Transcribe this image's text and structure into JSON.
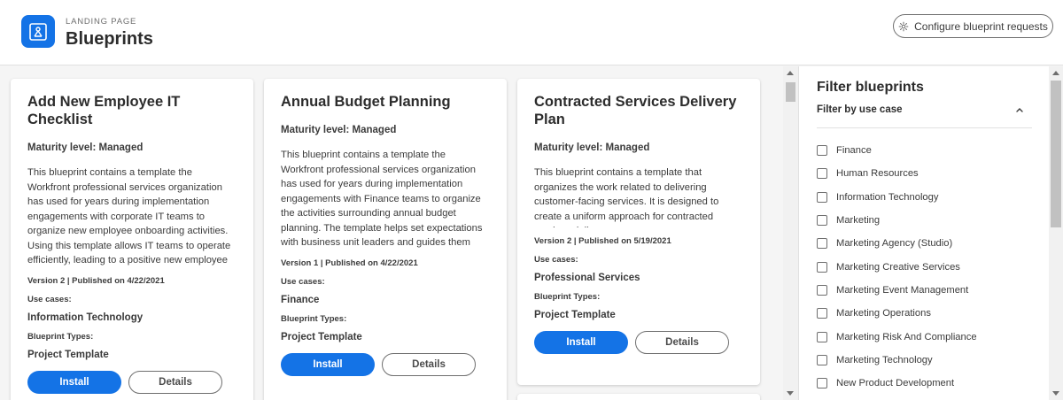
{
  "header": {
    "eyebrow": "LANDING PAGE",
    "title": "Blueprints",
    "config_button": "Configure blueprint requests"
  },
  "labels": {
    "use_cases": "Use cases:",
    "blueprint_types": "Blueprint Types:",
    "install": "Install",
    "details": "Details"
  },
  "cards": [
    {
      "title": "Add New Employee IT Checklist",
      "maturity": "Maturity level: Managed",
      "description": "This blueprint contains a template the Workfront professional services organization has used for years during implementation engagements with corporate IT teams to organize new employee onboarding activities. Using this template allows IT teams to operate efficiently, leading to a positive new employee experience and faster…",
      "version": "Version 2 | Published on 4/22/2021",
      "use_case": "Information Technology",
      "blueprint_type": "Project Template"
    },
    {
      "title": "Annual Budget Planning",
      "maturity": "Maturity level: Managed",
      "description": "This blueprint contains a template the Workfront professional services organization has used for years during implementation engagements with Finance teams to organize the activities surrounding annual budget planning. The template helps set expectations with business unit leaders and guides them through the proce…",
      "version": "Version 1 | Published on 4/22/2021",
      "use_case": "Finance",
      "blueprint_type": "Project Template"
    },
    {
      "title": "Contracted Services Delivery Plan",
      "maturity": "Maturity level: Managed",
      "description": "This blueprint contains a template that organizes the work related to delivering customer-facing services. It is designed to create a uniform approach for contracted services delivery.",
      "version": "Version 2 | Published on 5/19/2021",
      "use_case": "Professional Services",
      "blueprint_type": "Project Template"
    }
  ],
  "filter": {
    "title": "Filter blueprints",
    "subtitle": "Filter by use case",
    "items": [
      "Finance",
      "Human Resources",
      "Information Technology",
      "Marketing",
      "Marketing Agency (Studio)",
      "Marketing Creative Services",
      "Marketing Event Management",
      "Marketing Operations",
      "Marketing Risk And Compliance",
      "Marketing Technology",
      "New Product Development"
    ]
  },
  "colors": {
    "accent": "#1473e6",
    "background": "#f5f5f5"
  }
}
